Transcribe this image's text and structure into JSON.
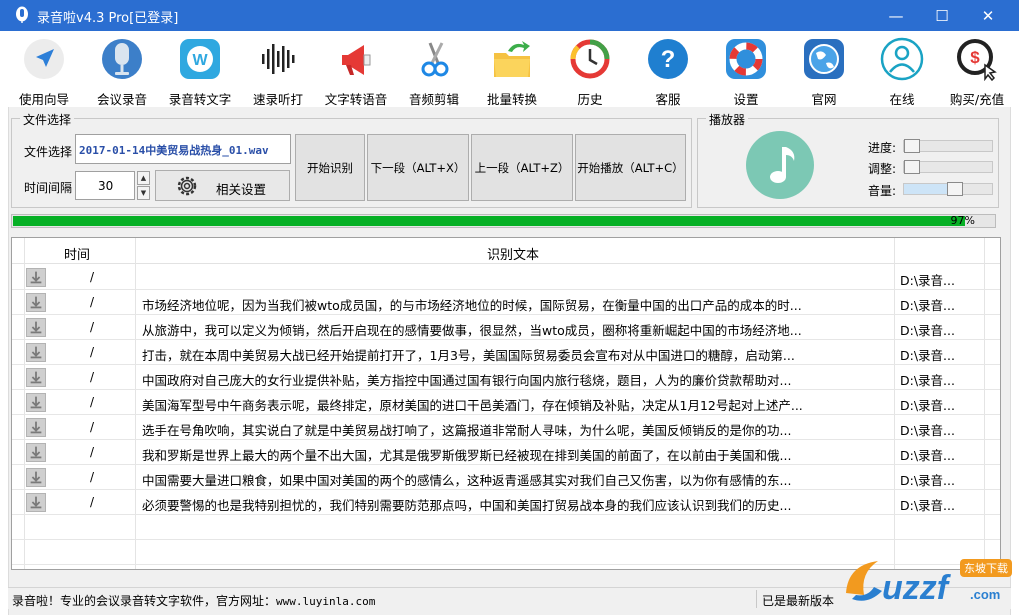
{
  "window": {
    "title": "录音啦v4.3 Pro[已登录]",
    "controls": {
      "minimize": "—",
      "maximize": "☐",
      "close": "✕"
    }
  },
  "toolbar": [
    {
      "id": "guide",
      "label": "使用向导",
      "icon": "navigation-arrow-icon"
    },
    {
      "id": "meeting",
      "label": "会议录音",
      "icon": "microphone-icon"
    },
    {
      "id": "audio2text",
      "label": "录音转文字",
      "icon": "w-word-icon"
    },
    {
      "id": "dictation",
      "label": "速录听打",
      "icon": "soundwave-icon"
    },
    {
      "id": "tts",
      "label": "文字转语音",
      "icon": "megaphone-icon"
    },
    {
      "id": "cut",
      "label": "音频剪辑",
      "icon": "scissors-icon"
    },
    {
      "id": "batch",
      "label": "批量转换",
      "icon": "folder-arrow-icon"
    },
    {
      "id": "history",
      "label": "历史",
      "icon": "history-clock-icon"
    },
    {
      "id": "support",
      "label": "客服",
      "icon": "help-question-icon"
    },
    {
      "id": "settings",
      "label": "设置",
      "icon": "lifebuoy-icon"
    },
    {
      "id": "website",
      "label": "官网",
      "icon": "globe-icon"
    },
    {
      "id": "online",
      "label": "在线",
      "icon": "user-icon"
    },
    {
      "id": "buy",
      "label": "购买/充值",
      "icon": "dollar-cursor-icon"
    }
  ],
  "file_group": {
    "title": "文件选择",
    "file_label": "文件选择",
    "file_value": "2017-01-14中美贸易战热身_01.wav",
    "interval_label": "时间间隔",
    "interval_value": "30",
    "settings_button": "相关设置"
  },
  "actions": {
    "start_recognition": "开始识别",
    "next_segment": "下一段（ALT+X）",
    "prev_segment": "上一段（ALT+Z）",
    "start_play": "开始播放（ALT+C）"
  },
  "player": {
    "title": "播放器",
    "progress_label": "进度:",
    "adjust_label": "调整:",
    "volume_label": "音量:",
    "progress_level": 0,
    "adjust_level": 0,
    "volume_level": 0.6
  },
  "progress": {
    "percent": 97,
    "text": "97%"
  },
  "table": {
    "columns": {
      "time": "时间",
      "text": "识别文本"
    },
    "rows": [
      {
        "time": "/",
        "text": "",
        "path": "D:\\录音..."
      },
      {
        "time": "/",
        "text": "市场经济地位呢，因为当我们被wto成员国，的与市场经济地位的时候，国际贸易，在衡量中国的出口产品的成本的时...",
        "path": "D:\\录音..."
      },
      {
        "time": "/",
        "text": "从旅游中，我可以定义为倾销，然后开启现在的感情要做事，很显然，当wto成员，圈称将重新崛起中国的市场经济地...",
        "path": "D:\\录音..."
      },
      {
        "time": "/",
        "text": "打击，就在本周中美贸易大战已经开始提前打开了，1月3号，美国国际贸易委员会宣布对从中国进口的糖醇，启动第...",
        "path": "D:\\录音..."
      },
      {
        "time": "/",
        "text": "中国政府对自己庞大的女行业提供补贴，美方指控中国通过国有银行向国内旅行毯烧，题目，人为的廉价贷款帮助对...",
        "path": "D:\\录音..."
      },
      {
        "time": "/",
        "text": "美国海军型号中午商务表示呢，最终排定，原材美国的进口干邑美酒门，存在倾销及补贴，决定从1月12号起对上述产...",
        "path": "D:\\录音..."
      },
      {
        "time": "/",
        "text": "选手在号角吹响，其实说白了就是中美贸易战打响了，这篇报道非常耐人寻味，为什么呢，美国反倾销反的是你的功...",
        "path": "D:\\录音..."
      },
      {
        "time": "/",
        "text": "我和罗斯是世界上最大的两个量不出大国，尤其是俄罗斯俄罗斯已经被现在排到美国的前面了，在以前由于美国和俄...",
        "path": "D:\\录音..."
      },
      {
        "time": "/",
        "text": "中国需要大量进口粮食，如果中国对美国的两个的感情么，这种返青遥感其实对我们自己又伤害，以为你有感情的东...",
        "path": "D:\\录音..."
      },
      {
        "time": "/",
        "text": "必须要警惕的也是我特别担忧的，我们特别需要防范那点吗，中国和美国打贸易战本身的我们应该认识到我们的历史...",
        "path": "D:\\录音..."
      }
    ]
  },
  "statusbar": {
    "left": "录音啦！专业的会议录音转文字软件，官方网址：",
    "url": "www.luyinla.com",
    "right": "已是最新版本"
  },
  "watermark": {
    "brand": "uzzf",
    "tag": "东坡下载",
    "domain": ".com"
  },
  "colors": {
    "titlebar": "#2b6ed1",
    "progress": "#06b025",
    "file_text": "#2a4fa8"
  }
}
